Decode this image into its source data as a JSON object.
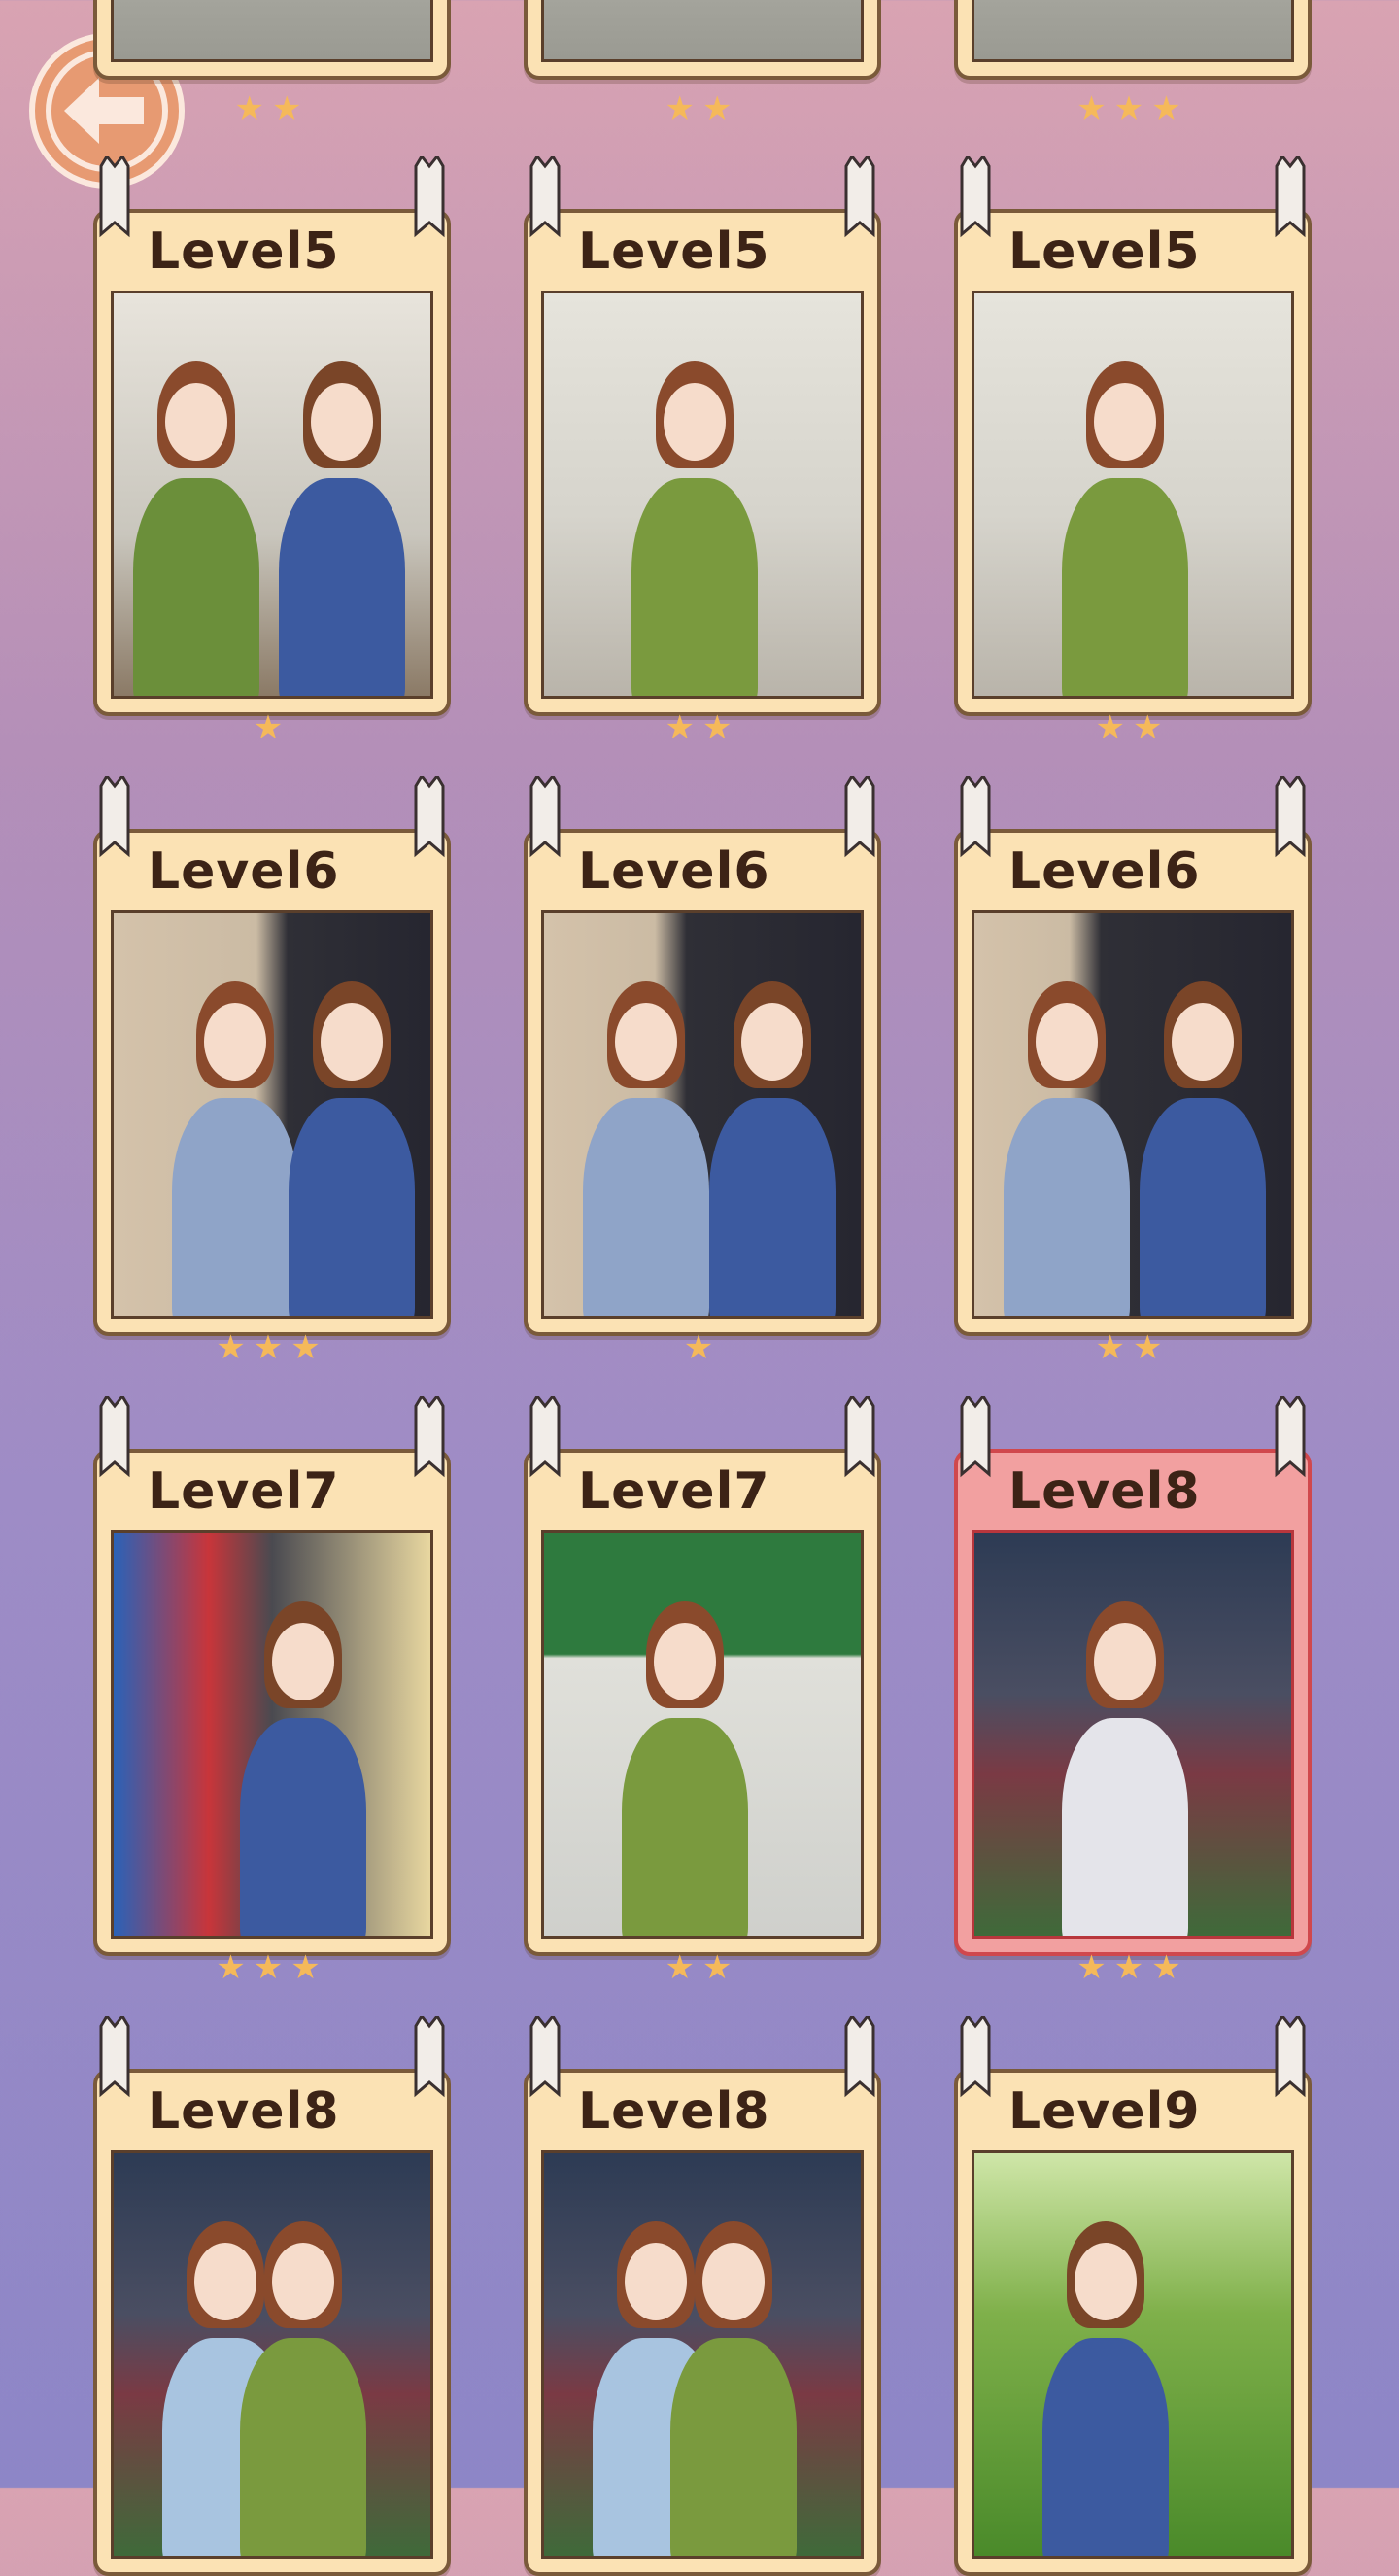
{
  "nav": {
    "back_icon": "back-arrow-icon"
  },
  "top_row_stars": [
    2,
    2,
    3
  ],
  "cards": [
    {
      "label": "Level5",
      "stars": 1,
      "current": false,
      "scene": "kitchen-couple"
    },
    {
      "label": "Level5",
      "stars": 2,
      "current": false,
      "scene": "kitchen-girl-bowl"
    },
    {
      "label": "Level5",
      "stars": 2,
      "current": false,
      "scene": "kitchen-girl-eating"
    },
    {
      "label": "Level6",
      "stars": 3,
      "current": false,
      "scene": "store-couple"
    },
    {
      "label": "Level6",
      "stars": 1,
      "current": false,
      "scene": "store-flowers"
    },
    {
      "label": "Level6",
      "stars": 2,
      "current": false,
      "scene": "store-shirt"
    },
    {
      "label": "Level7",
      "stars": 3,
      "current": false,
      "scene": "boy-vending"
    },
    {
      "label": "Level7",
      "stars": 2,
      "current": false,
      "scene": "girl-ball"
    },
    {
      "label": "Level8",
      "stars": 3,
      "current": true,
      "scene": "stadium-boy"
    },
    {
      "label": "Level8",
      "stars": 0,
      "current": false,
      "scene": "stadium-hug"
    },
    {
      "label": "Level8",
      "stars": 0,
      "current": false,
      "scene": "stadium-hug-angry"
    },
    {
      "label": "Level9",
      "stars": 0,
      "current": false,
      "scene": "forest-boy"
    }
  ],
  "colors": {
    "card_bg": "#fbe2b4",
    "card_border": "#7a5a3a",
    "current_bg": "#f2a0a0",
    "current_border": "#d0484d",
    "star": "#f5b95a"
  }
}
